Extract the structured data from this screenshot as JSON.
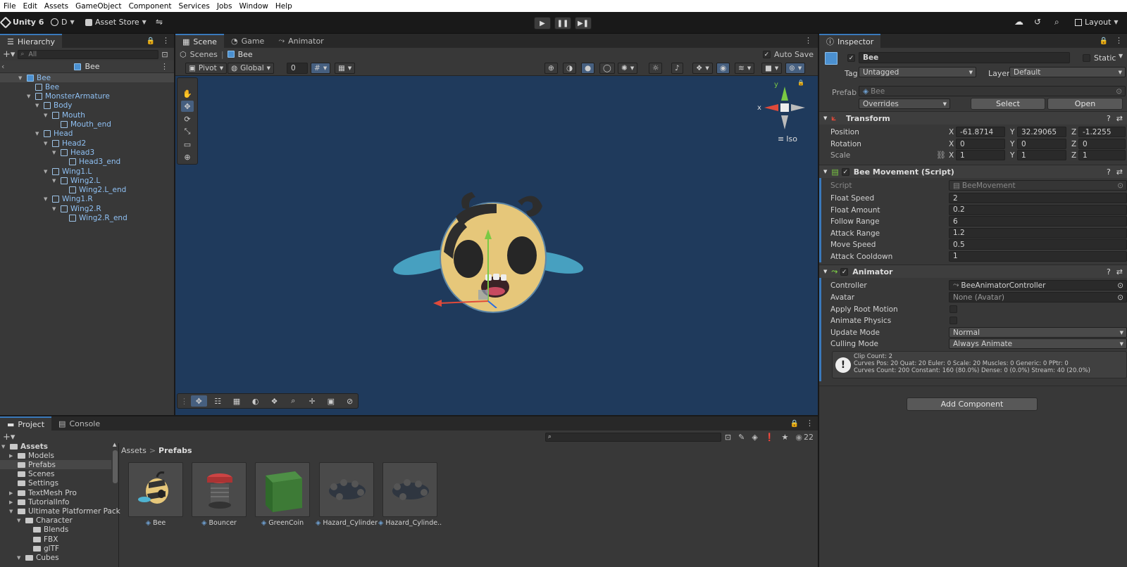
{
  "menu": [
    "File",
    "Edit",
    "Assets",
    "GameObject",
    "Component",
    "Services",
    "Jobs",
    "Window",
    "Help"
  ],
  "toolbar": {
    "unity_label": "Unity 6",
    "account_label": "D",
    "asset_store_label": "Asset Store",
    "layout_label": "Layout"
  },
  "hierarchy": {
    "tab": "Hierarchy",
    "search_placeholder": "All",
    "header": "Bee",
    "items": [
      {
        "label": "Bee",
        "depth": 0,
        "arrow": true
      },
      {
        "label": "Bee",
        "depth": 1,
        "arrow": false
      },
      {
        "label": "MonsterArmature",
        "depth": 1,
        "arrow": true
      },
      {
        "label": "Body",
        "depth": 2,
        "arrow": true
      },
      {
        "label": "Mouth",
        "depth": 3,
        "arrow": true
      },
      {
        "label": "Mouth_end",
        "depth": 4,
        "arrow": false
      },
      {
        "label": "Head",
        "depth": 2,
        "arrow": true
      },
      {
        "label": "Head2",
        "depth": 3,
        "arrow": true
      },
      {
        "label": "Head3",
        "depth": 4,
        "arrow": true
      },
      {
        "label": "Head3_end",
        "depth": 5,
        "arrow": false
      },
      {
        "label": "Wing1.L",
        "depth": 3,
        "arrow": true
      },
      {
        "label": "Wing2.L",
        "depth": 4,
        "arrow": true
      },
      {
        "label": "Wing2.L_end",
        "depth": 5,
        "arrow": false
      },
      {
        "label": "Wing1.R",
        "depth": 3,
        "arrow": true
      },
      {
        "label": "Wing2.R",
        "depth": 4,
        "arrow": true
      },
      {
        "label": "Wing2.R_end",
        "depth": 5,
        "arrow": false
      }
    ]
  },
  "scene": {
    "tabs": [
      "Scene",
      "Game",
      "Animator"
    ],
    "breadcrumb_root": "Scenes",
    "breadcrumb_current": "Bee",
    "auto_save": "Auto Save",
    "pivot": "Pivot",
    "global": "Global",
    "snap_value": "0",
    "iso_label": "Iso",
    "gizmo_x": "x",
    "gizmo_y": "y"
  },
  "inspector": {
    "tab": "Inspector",
    "object_name": "Bee",
    "static_label": "Static",
    "tag_label": "Tag",
    "tag_value": "Untagged",
    "layer_label": "Layer",
    "layer_value": "Default",
    "prefab_label": "Prefab",
    "prefab_value": "Bee",
    "overrides": "Overrides",
    "select_btn": "Select",
    "open_btn": "Open",
    "transform": {
      "title": "Transform",
      "position_label": "Position",
      "rotation_label": "Rotation",
      "scale_label": "Scale",
      "position": {
        "x": "-61.8714",
        "y": "32.29065",
        "z": "-1.2255"
      },
      "rotation": {
        "x": "0",
        "y": "0",
        "z": "0"
      },
      "scale": {
        "x": "1",
        "y": "1",
        "z": "1"
      },
      "axis_x": "X",
      "axis_y": "Y",
      "axis_z": "Z"
    },
    "bee_movement": {
      "title": "Bee Movement (Script)",
      "script_label": "Script",
      "script_value": "BeeMovement",
      "fields": [
        {
          "label": "Float Speed",
          "value": "2"
        },
        {
          "label": "Float Amount",
          "value": "0.2"
        },
        {
          "label": "Follow Range",
          "value": "6"
        },
        {
          "label": "Attack Range",
          "value": "1.2"
        },
        {
          "label": "Move Speed",
          "value": "0.5"
        },
        {
          "label": "Attack Cooldown",
          "value": "1"
        }
      ]
    },
    "animator": {
      "title": "Animator",
      "controller_label": "Controller",
      "controller_value": "BeeAnimatorController",
      "avatar_label": "Avatar",
      "avatar_value": "None (Avatar)",
      "root_motion_label": "Apply Root Motion",
      "animate_physics_label": "Animate Physics",
      "update_mode_label": "Update Mode",
      "update_mode_value": "Normal",
      "culling_mode_label": "Culling Mode",
      "culling_mode_value": "Always Animate",
      "info_line1": "Clip Count: 2",
      "info_line2": "Curves Pos: 20 Quat: 20 Euler: 0 Scale: 20 Muscles: 0 Generic: 0 PPtr: 0",
      "info_line3": "Curves Count: 200 Constant: 160 (80.0%) Dense: 0 (0.0%) Stream: 40 (20.0%)"
    },
    "add_component": "Add Component"
  },
  "project": {
    "tabs": [
      "Project",
      "Console"
    ],
    "count": "22",
    "breadcrumb_root": "Assets",
    "breadcrumb_current": "Prefabs",
    "tree": [
      {
        "label": "Assets",
        "depth": 0,
        "arrow": "down",
        "bold": true
      },
      {
        "label": "Models",
        "depth": 1,
        "arrow": "right"
      },
      {
        "label": "Prefabs",
        "depth": 1,
        "arrow": "",
        "selected": true
      },
      {
        "label": "Scenes",
        "depth": 1,
        "arrow": ""
      },
      {
        "label": "Settings",
        "depth": 1,
        "arrow": ""
      },
      {
        "label": "TextMesh Pro",
        "depth": 1,
        "arrow": "right"
      },
      {
        "label": "TutorialInfo",
        "depth": 1,
        "arrow": "right"
      },
      {
        "label": "Ultimate Platformer Pack",
        "depth": 1,
        "arrow": "down"
      },
      {
        "label": "Character",
        "depth": 2,
        "arrow": "down"
      },
      {
        "label": "Blends",
        "depth": 3,
        "arrow": ""
      },
      {
        "label": "FBX",
        "depth": 3,
        "arrow": ""
      },
      {
        "label": "glTF",
        "depth": 3,
        "arrow": ""
      },
      {
        "label": "Cubes",
        "depth": 2,
        "arrow": "down"
      }
    ],
    "assets": [
      "Bee",
      "Bouncer",
      "GreenCoin",
      "Hazard_Cylinder",
      "Hazard_Cylinde..."
    ]
  }
}
